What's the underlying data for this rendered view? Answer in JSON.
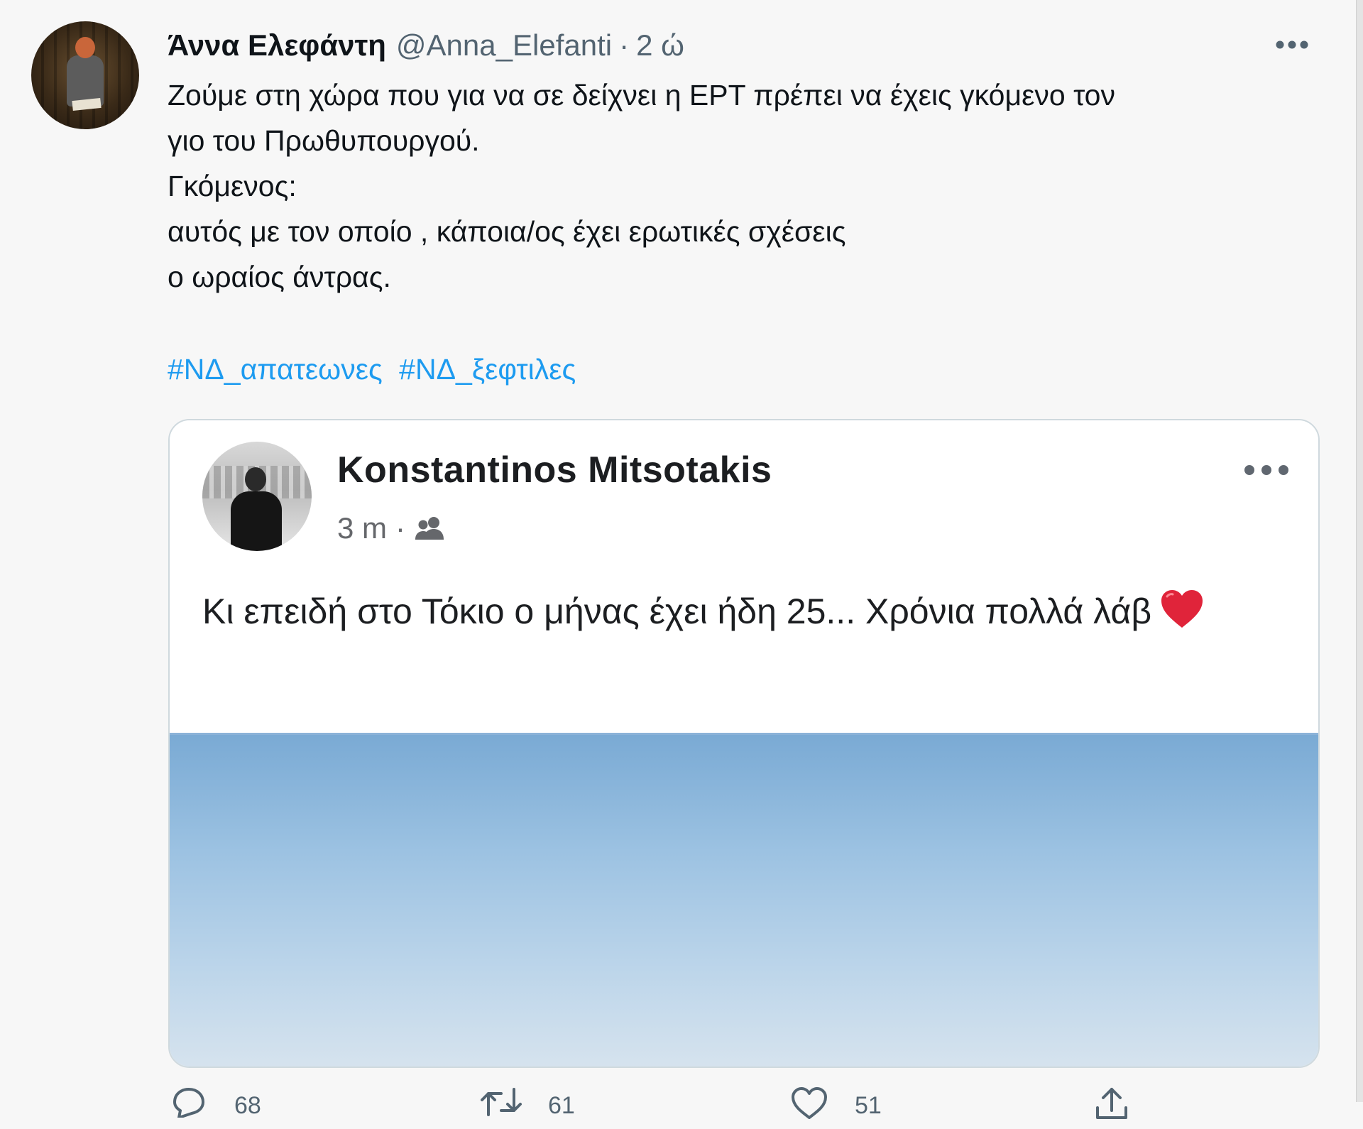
{
  "tweet": {
    "author": {
      "display_name": "Άννα Ελεφάντη",
      "handle": "@Anna_Elefanti",
      "separator": "·",
      "time": "2 ώ"
    },
    "text": "Ζούμε στη χώρα που για να σε δείχνει η ΕΡΤ πρέπει να έχεις γκόμενο τον\nγιο του Πρωθυπουργού.\nΓκόμενος:\nαυτός με τον οποίο , κάποια/ος έχει ερωτικές σχέσεις\nο ωραίος άντρας.",
    "hashtags": [
      "#ΝΔ_απατεωνες",
      "#ΝΔ_ξεφτιλες"
    ],
    "icons": {
      "more": "more-horizontal-icon",
      "reply": "reply-icon",
      "retweet": "retweet-icon",
      "like": "heart-icon",
      "share": "share-icon"
    },
    "actions": {
      "replies": "68",
      "retweets": "61",
      "likes": "51"
    }
  },
  "embedded_post": {
    "author_name": "Konstantinos Mitsotakis",
    "time": "3 m",
    "separator": "·",
    "audience_icon": "friends-icon",
    "text": "Κι επειδή στο Τόκιο ο μήνας έχει ήδη 25... Χρόνια πολλά λάβ",
    "emoji_icon": "red-heart-icon"
  },
  "colors": {
    "link": "#1d9bf0",
    "muted": "#536471",
    "text": "#0f1419",
    "background": "#f7f7f7",
    "heart": "#e0245e"
  }
}
